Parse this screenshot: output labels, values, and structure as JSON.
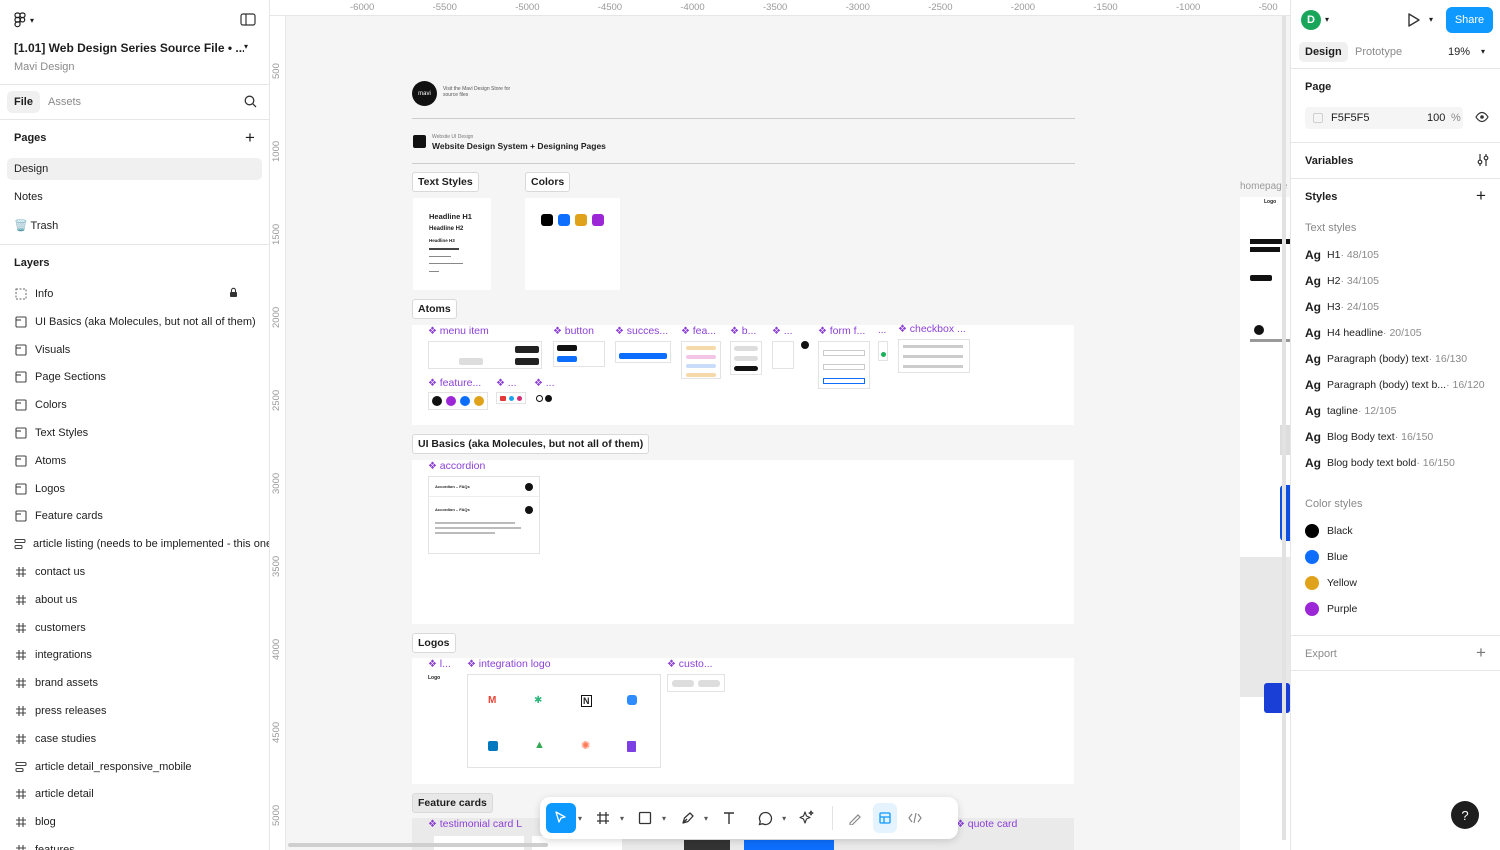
{
  "file": {
    "title": "[1.01] Web Design Series Source File • ...",
    "team": "Mavi Design"
  },
  "left_tabs": {
    "file": "File",
    "assets": "Assets"
  },
  "pages": {
    "header": "Pages",
    "items": [
      "Design",
      "Notes",
      "🗑️ Trash"
    ]
  },
  "layers": {
    "header": "Layers",
    "items": [
      {
        "icon": "info-frame",
        "label": "Info",
        "locked": true
      },
      {
        "icon": "section",
        "label": "UI Basics (aka Molecules, but not all of them)"
      },
      {
        "icon": "section",
        "label": "Visuals"
      },
      {
        "icon": "section",
        "label": "Page Sections"
      },
      {
        "icon": "section",
        "label": "Colors"
      },
      {
        "icon": "section",
        "label": "Text Styles"
      },
      {
        "icon": "section",
        "label": "Atoms"
      },
      {
        "icon": "section",
        "label": "Logos"
      },
      {
        "icon": "section",
        "label": "Feature cards"
      },
      {
        "icon": "auto-layout",
        "label": "article listing (needs to be implemented - this one"
      },
      {
        "icon": "frame",
        "label": "contact us"
      },
      {
        "icon": "frame",
        "label": "about us"
      },
      {
        "icon": "frame",
        "label": "customers"
      },
      {
        "icon": "frame",
        "label": "integrations"
      },
      {
        "icon": "frame",
        "label": "brand assets"
      },
      {
        "icon": "frame",
        "label": "press releases"
      },
      {
        "icon": "frame",
        "label": "case studies"
      },
      {
        "icon": "auto-layout",
        "label": "article detail_responsive_mobile"
      },
      {
        "icon": "frame",
        "label": "article detail"
      },
      {
        "icon": "frame",
        "label": "blog"
      },
      {
        "icon": "frame",
        "label": "features"
      }
    ]
  },
  "ruler": {
    "top": [
      "-6000",
      "-5500",
      "-5000",
      "-4500",
      "-4000",
      "-3500",
      "-3000",
      "-2500",
      "-2000",
      "-1500",
      "-1000",
      "-500"
    ],
    "left": [
      "500",
      "1000",
      "1500",
      "2000",
      "2500",
      "3000",
      "3500",
      "4000",
      "4500",
      "5000"
    ]
  },
  "canvas": {
    "info_text": "Visit the Mavi Design Store for source files",
    "logo_text": "mavi",
    "header_small": "Website UI Design",
    "header_title": "Website Design System + Designing Pages",
    "sections": {
      "text_styles": "Text Styles",
      "colors": "Colors",
      "atoms": "Atoms",
      "ui_basics": "UI Basics (aka Molecules, but not all of them)",
      "logos": "Logos",
      "feature_cards": "Feature cards"
    },
    "text_samples": [
      "Headline H1",
      "Headline H2",
      "Headline H3",
      "Headline H4"
    ],
    "components": {
      "menu_item": "menu item",
      "button": "button",
      "success": "succes...",
      "fea": "fea...",
      "b": "b...",
      "dots1": "...",
      "form": "form f...",
      "checkbox": "checkbox ...",
      "feature": "feature...",
      "dots2": "...",
      "dots3": "...",
      "accordion": "accordion",
      "l": "l...",
      "integration_logo": "integration logo",
      "custo": "custo...",
      "testimonial": "testimonial card L",
      "quote": "quote card"
    },
    "accordion_rows": [
      "Accordion – FAQs",
      "Accordion – FAQs"
    ],
    "homepage_label": "homepage",
    "logo_label": "Logo"
  },
  "right": {
    "avatar": "D",
    "share": "Share",
    "tabs": {
      "design": "Design",
      "prototype": "Prototype"
    },
    "zoom": "19%",
    "page_header": "Page",
    "page_color": "F5F5F5",
    "page_opacity": "100",
    "percent": "%",
    "variables": "Variables",
    "styles": "Styles",
    "text_styles_header": "Text styles",
    "text_styles": [
      {
        "name": "H1",
        "meta": " · 48/105"
      },
      {
        "name": "H2",
        "meta": " · 34/105"
      },
      {
        "name": "H3",
        "meta": " · 24/105"
      },
      {
        "name": "H4 headline",
        "meta": " · 20/105"
      },
      {
        "name": "Paragraph (body) text",
        "meta": " · 16/130"
      },
      {
        "name": "Paragraph (body) text b...",
        "meta": " · 16/120"
      },
      {
        "name": "tagline",
        "meta": " · 12/105"
      },
      {
        "name": "Blog Body text",
        "meta": " · 16/150"
      },
      {
        "name": "Blog body text bold",
        "meta": " · 16/150"
      }
    ],
    "color_styles_header": "Color styles",
    "color_styles": [
      {
        "name": "Black",
        "color": "#000000"
      },
      {
        "name": "Blue",
        "color": "#0d6efd"
      },
      {
        "name": "Yellow",
        "color": "#e0a21a"
      },
      {
        "name": "Purple",
        "color": "#9b27d6"
      }
    ],
    "export": "Export",
    "help": "?"
  },
  "colors": {
    "accent": "#0d99ff",
    "component_purple": "#8b3fd8"
  }
}
